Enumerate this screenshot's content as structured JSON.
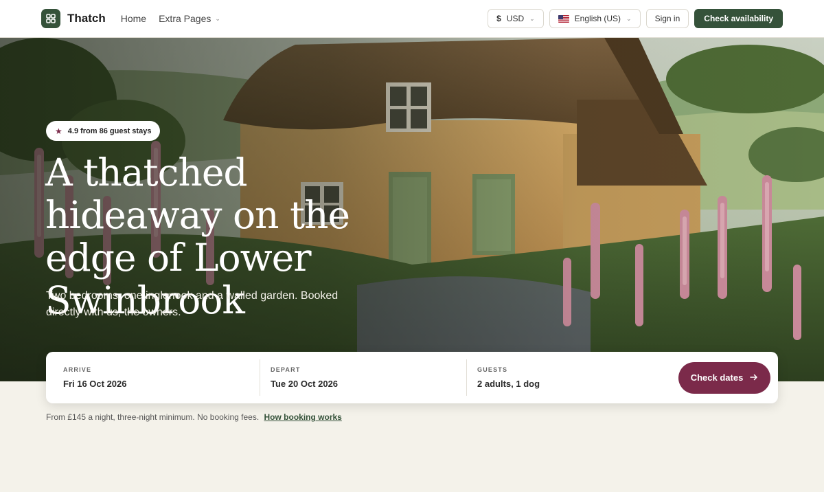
{
  "header": {
    "brand": "Thatch",
    "nav": [
      {
        "label": "Home"
      },
      {
        "label": "Extra Pages"
      }
    ],
    "currency": {
      "symbol": "$",
      "code": "USD"
    },
    "language": "English (US)",
    "sign_in": "Sign in",
    "cta": "Check availability"
  },
  "hero": {
    "rating": "4.9 from 86 guest stays",
    "title": "A thatched hideaway on the edge of Lower Swinbrook",
    "subtitle": "Two bedrooms, one inglenook and a walled garden. Booked directly with us, the owners."
  },
  "booking": {
    "arrive": {
      "label": "ARRIVE",
      "value": "Fri 16 Oct 2026"
    },
    "depart": {
      "label": "DEPART",
      "value": "Tue 20 Oct 2026"
    },
    "guests": {
      "label": "GUESTS",
      "value": "2 adults, 1 dog"
    },
    "button": "Check dates"
  },
  "footnote": {
    "text": "From £145 a night, three-night minimum. No booking fees.",
    "link": "How booking works"
  },
  "colors": {
    "brand_green": "#35523a",
    "accent_plum": "#7b2a4a",
    "page_bg": "#f4f2ea"
  },
  "icons": {
    "brand": "grid-icon",
    "rating": "star-icon",
    "button_arrow": "arrow-right-icon"
  }
}
